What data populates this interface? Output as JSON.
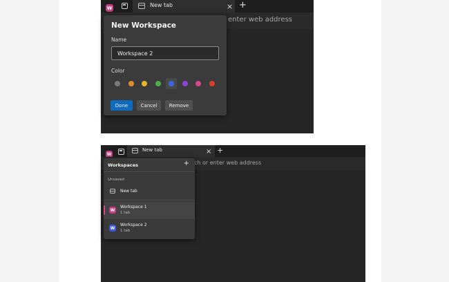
{
  "colors": {
    "page_bg": "#ffffff",
    "browser_bg": "#262626",
    "accent_blue": "#0f6cbd",
    "workspace_pink": "#c43f82",
    "workspace_blue": "#3e57d6"
  },
  "top_screenshot": {
    "workspace_badge": "W",
    "tab": {
      "title": "New tab",
      "close_icon": "×"
    },
    "new_tab_icon": "+",
    "address_placeholder": "enter web address",
    "dialog": {
      "title": "New Workspace",
      "name_label": "Name",
      "name_value": "Workspace 2",
      "color_label": "Color",
      "colors": [
        "#7a7a7a",
        "#e08a2e",
        "#e5b829",
        "#4caf50",
        "#3f66e0",
        "#8a44d8",
        "#d6478c",
        "#d8402c"
      ],
      "selected_color_index": 4,
      "buttons": {
        "done": "Done",
        "cancel": "Cancel",
        "remove": "Remove"
      }
    }
  },
  "bottom_screenshot": {
    "workspace_badge": "W",
    "tab": {
      "title": "New tab",
      "close_icon": "×"
    },
    "new_tab_icon": "+",
    "address_placeholder": "ch or enter web address",
    "panel": {
      "title": "Workspaces",
      "add_icon": "+",
      "section_label": "Unsaved",
      "unsaved_item": "New tab",
      "workspaces": [
        {
          "badge": "W",
          "name": "Workspace 1",
          "tabs": "1 tab",
          "color": "#c43f82",
          "active": true
        },
        {
          "badge": "W",
          "name": "Workspace 2",
          "tabs": "1 tab",
          "color": "#3e57d6",
          "active": false
        }
      ]
    }
  }
}
